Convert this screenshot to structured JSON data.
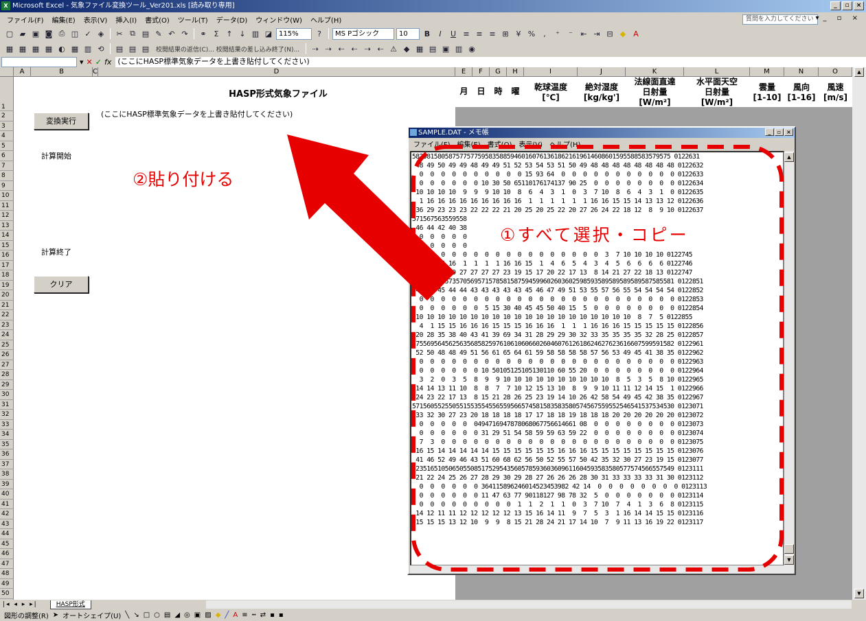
{
  "window": {
    "title": "Microsoft Excel - 気象ファイル変換ツール_Ver201.xls [読み取り専用]",
    "app_icon": "excel-icon"
  },
  "menu": {
    "items": [
      "ファイル(F)",
      "編集(E)",
      "表示(V)",
      "挿入(I)",
      "書式(O)",
      "ツール(T)",
      "データ(D)",
      "ウィンドウ(W)",
      "ヘルプ(H)"
    ],
    "help_placeholder": "質問を入力してください"
  },
  "toolbar": {
    "zoom": "115%",
    "font_name": "MS Pゴシック",
    "font_size": "10",
    "review_text": "校閲結果の返信(C)... 校閲結果の差し込み終了(N)..."
  },
  "formula_bar": {
    "fx": "fx",
    "content": "(ここにHASP標準気象データを上書き貼付してください)"
  },
  "columns": [
    "A",
    "B",
    "C",
    "D",
    "E",
    "F",
    "G",
    "H",
    "I",
    "J",
    "K",
    "L",
    "M",
    "N",
    "O"
  ],
  "header": {
    "title": "HASP形式気象ファイル",
    "month": "月",
    "day": "日",
    "hour": "時",
    "weekday": "曜",
    "dry_bulb": "乾球温度",
    "dry_bulb_unit": "[℃]",
    "abs_humidity": "絶対湿度",
    "abs_humidity_unit": "[kg/kg']",
    "direct": "法線面直達",
    "direct2": "日射量",
    "direct_unit": "[W/m²]",
    "horizontal": "水平面天空",
    "horizontal2": "日射量",
    "horizontal_unit": "[W/m²]",
    "cloud": "雲量",
    "cloud_unit": "[1-10]",
    "wind_dir": "風向",
    "wind_dir_unit": "[1-16]",
    "wind_speed": "風速",
    "wind_speed_unit": "[m/s]"
  },
  "sheet": {
    "paste_hint": "(ここにHASP標準気象データを上書き貼付してください)",
    "convert_button": "変換実行",
    "calc_start": "計算開始",
    "calc_end": "計算終了",
    "clear_button": "クリア"
  },
  "notepad": {
    "title": "SAMPLE.DAT - メモ帳",
    "menu": [
      "ファイル(F)",
      "編集(E)",
      "書式(O)",
      "表示(V)",
      "ヘルプ(H)"
    ],
    "lines": [
      "58258158058757757759583588594601607613618621619614608601595588583579575 0122631",
      " 48 49 50 49 49 48 49 49 51 52 53 54 53 51 50 49 48 48 48 48 48 48 48 48 0122632",
      "  0  0  0  0  0  0  0  0  0  0 15 93 64  0  0  0  0  0  0  0  0  0  0  0 0122633",
      "  0  0  0  0  0  0 10 30 50 65110176174137 90 25  0  0  0  0  0  0  0  0 0122634",
      " 10 10 10 10  9  9  9 10 10  8  6  4  3  1  0  3  7 10  8  6  4  3  1  0 0122635",
      "  1 16 16 16 16 16 16 16 16 16  1  1  1  1  1  1 16 16 15 15 14 13 13 12 0122636",
      " 36 29 23 23 23 22 22 22 21 20 25 20 25 22 20 27 26 24 22 18 12  8  9 10 0122637",
      "571567563559558",
      " 46 44 42 40 38",
      "  0  0  0  0  0",
      "  0  0  0  0  0",
      "  0  0  0  0  0  0  0  0  0  0  0  0  0  0  0  0  0  3  7 10 10 10 10 0122745",
      " 15 15 16 16  1  1  1  1 16 16 15  1  4  6  5  4  3  4  5  6  6  6  6 0122746",
      " 31 31 31 29 27 27 27 27 23 19 15 17 20 22 17 13  8 14 21 27 22 18 13 0122747",
      "597597578573570569571578581587594599602603602598593589589589589587585581 0122851",
      " 45 45 45 44 44 43 43 43 43 43 45 46 47 49 51 53 55 57 56 55 54 54 54 54 0122852",
      "  0  0  0  0  0  0  0  0  0  0  0  0  0  0  0  0  0  0  0  0  0  0  0  0 0122853",
      "  0  0  0  0  0  0  5 15 30 40 45 45 50 40 15  5  0  0  0  0  0  0  0  0 0122854",
      " 10 10 10 10 10 10 10 10 10 10 10 10 10 10 10 10 10 10 10 10  8  7  5 0122855",
      "  4  1 15 15 16 16 16 15 15 15 16 16 16  1  1  1 16 16 16 15 15 15 15 15 0122856",
      " 20 28 35 38 40 43 41 39 69 34 31 28 29 29 30 32 33 35 35 35 35 32 28 25 0122857",
      "575569564562563568582597610610606602604607612618624627623616607599591582 0122961",
      " 52 50 48 48 49 51 56 61 65 64 61 59 58 58 58 58 57 56 53 49 45 41 38 35 0122962",
      "  0  0  0  0  0  0  0  0  0  0  0  0  0  0  0  0  0  0  0  0  0  0  0  0 0122963",
      "  0  0  0  0  0  0 10 50105125105130110 60 55 20  0  0  0  0  0  0  0  0 0122964",
      "  3  2  0  3  5  8  9  9 10 10 10 10 10 10 10 10 10 10  8  5  3  5  8 10 0122965",
      " 14 14 13 11 10  8  8  7  7 10 12 15 13 10  8  9  9 10 11 11 12 14 15  1 0122966",
      " 24 23 22 17 13  8 15 21 28 26 25 23 19 14 10 26 42 58 54 49 45 42 38 35 0122967",
      "571560552550551553554556559566574581583583580574567559552546541537534530 0123071",
      " 33 32 30 27 23 20 18 18 18 18 17 17 18 18 19 18 18 18 20 20 20 20 20 20 0123072",
      "  0  0  0  0  0  0494716947878068067756614661 08  0  0  0  0  0  0  0  0 0123073",
      "  0  0  0  0  0  0 31 29 51 54 58 59 59 63 59 22  0  0  0  0  0  0  0  0 0123074",
      "  7  3  0  0  0  0  0  0  0  0  0  0  0  0  0  0  0  0  0  0  0  0  0  0 0123075",
      " 16 15 14 14 14 14 14 15 15 15 15 15 15 16 16 16 15 15 15 15 15 15 15 15 0123076",
      " 41 46 52 49 46 43 51 60 68 62 56 50 52 55 57 50 42 35 32 30 27 23 19 15 0123077",
      "523516510506505508517529543560578593603609611604593583580577574566557549 0123111",
      " 21 22 24 25 26 27 28 29 30 29 28 27 26 26 26 28 30 31 33 33 33 33 31 30 0123112",
      "  0  0  0  0  0  0 364115896246014523453982 42 14  0  0  0  0  0  0  0  0 0123113",
      "  0  0  0  0  0  0 11 47 63 77 90118127 98 78 32  5  0  0  0  0  0  0  0 0123114",
      "  0  0  0  0  0  0  0  0  0  1  1  2  1  1  0  3  7 10  7  4  1  3  6  8 0123115",
      " 14 12 11 11 12 12 12 12 12 13 15 16 14 11  9  7  5  3  1 16 14 14 15 15 0123116",
      " 15 15 15 13 12 10  9  9  8 15 21 28 24 21 17 14 10  7  9 11 13 16 19 22 0123117"
    ]
  },
  "annotations": {
    "paste": "②貼り付ける",
    "copy": "①すべて選択・コピー",
    "color": "#e60000"
  },
  "sheet_tab": "HASP形式",
  "drawbar": {
    "draw": "図形の調整(R)",
    "autoshape": "オートシェイプ(U)"
  }
}
